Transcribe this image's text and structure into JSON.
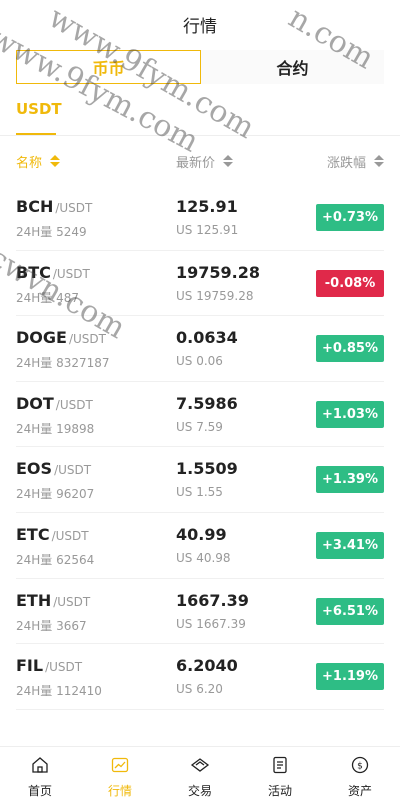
{
  "header": {
    "title": "行情"
  },
  "segments": {
    "spot": "币币",
    "contract": "合约"
  },
  "subtab": {
    "label": "USDT"
  },
  "columns": {
    "name": "名称",
    "price": "最新价",
    "change": "涨跌幅"
  },
  "colors": {
    "accent": "#f0b90b",
    "up": "#2ebd85",
    "down": "#e0294a"
  },
  "rows": [
    {
      "symbol": "BCH",
      "quote": "/USDT",
      "volume": "24H量 5249",
      "price": "125.91",
      "usd": "US 125.91",
      "change": "+0.73%",
      "direction": "up"
    },
    {
      "symbol": "BTC",
      "quote": "/USDT",
      "volume": "24H量 487",
      "price": "19759.28",
      "usd": "US 19759.28",
      "change": "-0.08%",
      "direction": "down"
    },
    {
      "symbol": "DOGE",
      "quote": "/USDT",
      "volume": "24H量 8327187",
      "price": "0.0634",
      "usd": "US 0.06",
      "change": "+0.85%",
      "direction": "up"
    },
    {
      "symbol": "DOT",
      "quote": "/USDT",
      "volume": "24H量 19898",
      "price": "7.5986",
      "usd": "US 7.59",
      "change": "+1.03%",
      "direction": "up"
    },
    {
      "symbol": "EOS",
      "quote": "/USDT",
      "volume": "24H量 96207",
      "price": "1.5509",
      "usd": "US 1.55",
      "change": "+1.39%",
      "direction": "up"
    },
    {
      "symbol": "ETC",
      "quote": "/USDT",
      "volume": "24H量 62564",
      "price": "40.99",
      "usd": "US 40.98",
      "change": "+3.41%",
      "direction": "up"
    },
    {
      "symbol": "ETH",
      "quote": "/USDT",
      "volume": "24H量 3667",
      "price": "1667.39",
      "usd": "US 1667.39",
      "change": "+6.51%",
      "direction": "up"
    },
    {
      "symbol": "FIL",
      "quote": "/USDT",
      "volume": "24H量 112410",
      "price": "6.2040",
      "usd": "US 6.20",
      "change": "+1.19%",
      "direction": "up"
    }
  ],
  "watermarks": [
    "www.9fym.com",
    "www.9fym.com",
    "cwvn.com",
    "n.com"
  ],
  "tabbar": [
    {
      "label": "首页",
      "icon": "home-icon",
      "active": false
    },
    {
      "label": "行情",
      "icon": "chart-icon",
      "active": true
    },
    {
      "label": "交易",
      "icon": "exchange-icon",
      "active": false
    },
    {
      "label": "活动",
      "icon": "document-icon",
      "active": false
    },
    {
      "label": "资产",
      "icon": "coin-icon",
      "active": false
    }
  ]
}
